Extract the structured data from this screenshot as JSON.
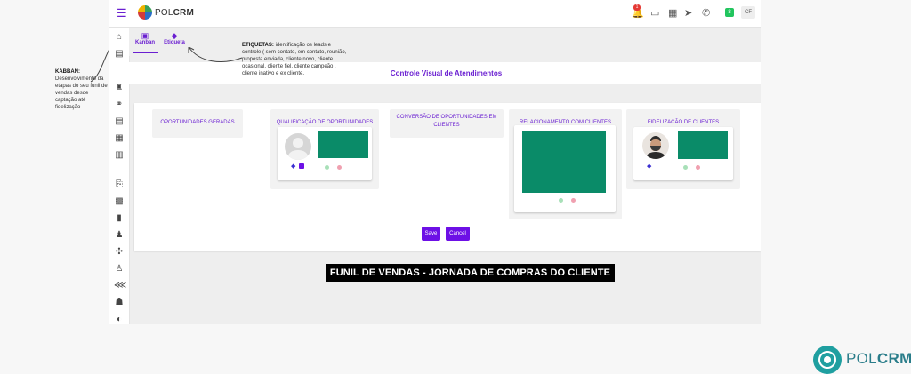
{
  "app": {
    "brand_prefix": "POL",
    "brand_suffix": "CRM",
    "notification_count": "1",
    "status_badge": "8",
    "user_initials": "CF"
  },
  "tabs": [
    {
      "label": "Kanban",
      "icon": "kanban-icon"
    },
    {
      "label": "Etiqueta",
      "icon": "tag-icon"
    }
  ],
  "annotations": {
    "kabban_title": "KABBAN:",
    "kabban_text": "Desenvolvimento da etapas do seu funil de vendas desde captação até fidelização",
    "etiquetas_title": "ETIQUETAS:",
    "etiquetas_text": "identificação os leads e controle ( sem contato, em contato, reunião, proposta enviada, cliente novo, cliente ocasional, cliente fiel, cliente campeão , cliente inativo e ex cliente."
  },
  "page_title": "Controle Visual de Atendimentos",
  "columns": [
    {
      "title": "OPORTUNIDADES GERADAS"
    },
    {
      "title": "QUALIFICAÇÃO DE OPORTUNIDADES"
    },
    {
      "title": "CONVERSÃO DE OPORTUNIDADES EM CLIENTES"
    },
    {
      "title": "RELACIONAMENTO COM CLIENTES"
    },
    {
      "title": "FIDELIZAÇÃO DE CLIENTES"
    }
  ],
  "buttons": {
    "save": "Save",
    "cancel": "Cancel"
  },
  "banner": "FUNIL DE VENDAS - JORNADA DE COMPRAS DO CLIENTE",
  "footer": {
    "brand_prefix": "POL",
    "brand_suffix": "CRM"
  },
  "colors": {
    "accent": "#6a1fd1",
    "card_green": "#0a8b68",
    "button": "#6d10e6"
  }
}
